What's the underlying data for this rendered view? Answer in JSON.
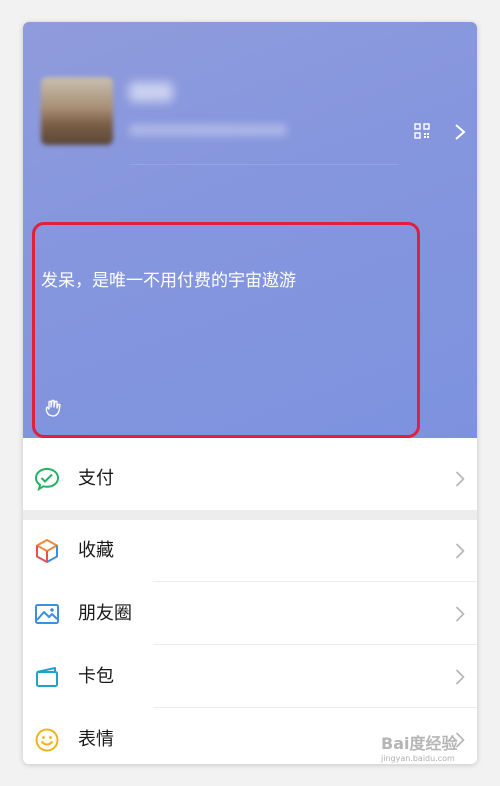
{
  "profile": {
    "nickname": "",
    "wechat_id": "",
    "qr_icon": "qr-code-icon",
    "chevron_icon": "chevron-right-icon",
    "status_text": "发呆，是唯一不用付费的宇宙遨游",
    "status_icon": "hand-icon",
    "highlight_color": "#e0203e"
  },
  "menu": {
    "items": [
      {
        "label": "支付",
        "icon": "pay-icon"
      },
      {
        "label": "收藏",
        "icon": "favorites-icon"
      },
      {
        "label": "朋友圈",
        "icon": "moments-icon"
      },
      {
        "label": "卡包",
        "icon": "card-wallet-icon"
      },
      {
        "label": "表情",
        "icon": "sticker-smile-icon"
      }
    ]
  },
  "colors": {
    "pay": "#20b362",
    "favorites_orange": "#f0883a",
    "favorites_blue": "#3b8ee0",
    "moments": "#3b8ee0",
    "card": "#19a5c8",
    "sticker": "#f2b318"
  },
  "watermark": {
    "brand": "Bai度经验",
    "url": "jingyan.baidu.com"
  }
}
